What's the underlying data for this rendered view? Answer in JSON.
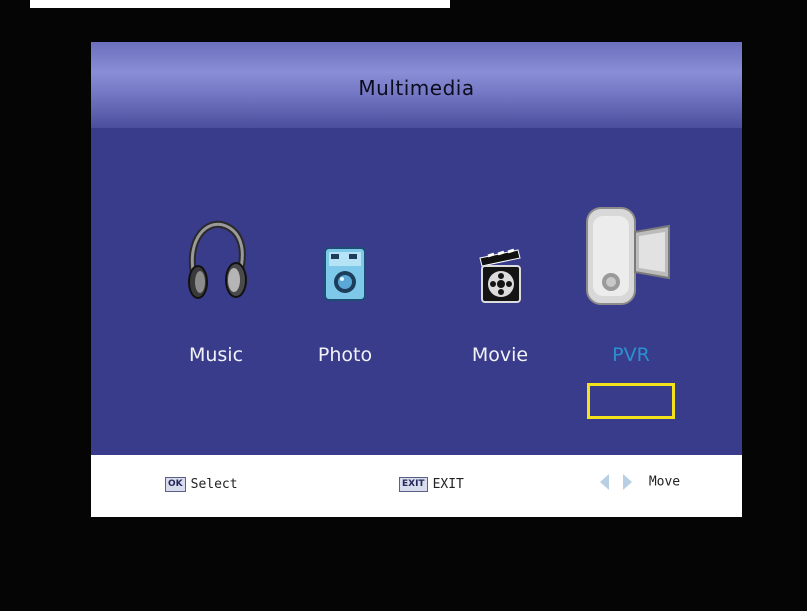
{
  "menu": {
    "title": "Multimedia",
    "items": [
      {
        "label": "Music",
        "icon": "headphones-icon"
      },
      {
        "label": "Photo",
        "icon": "camera-icon"
      },
      {
        "label": "Movie",
        "icon": "film-reel-icon"
      },
      {
        "label": "PVR",
        "icon": "camcorder-icon",
        "selected": true
      }
    ]
  },
  "footer": {
    "select_key": "OK",
    "select_label": "Select",
    "exit_key": "EXIT",
    "exit_label": "EXIT",
    "move_label": "Move"
  },
  "colors": {
    "panel": "#3c3f8e",
    "highlight": "#f4e21a",
    "selected_text": "#2b8fd0"
  }
}
